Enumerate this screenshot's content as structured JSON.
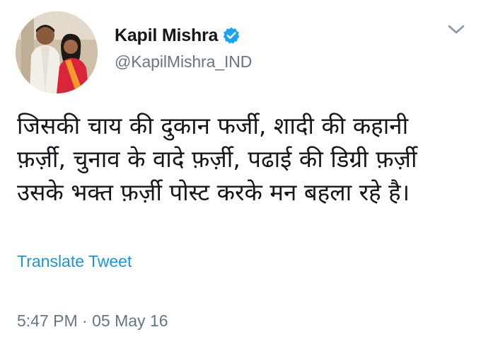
{
  "user": {
    "display_name": "Kapil Mishra",
    "handle": "@KapilMishra_IND",
    "verified": true
  },
  "tweet": {
    "text_lines": [
      "जिसकी चाय की दुकान फर्जी, शादी की कहानी",
      "फ़र्ज़ी, चुनाव के वादे फ़र्ज़ी, पढाई की डिग्री फ़र्ज़ी",
      "उसके भक्त फ़र्ज़ी पोस्ट करके मन बहला रहे है।"
    ],
    "translate_label": "Translate Tweet",
    "timestamp": "5:47 PM · 05 May 16"
  },
  "icons": {
    "verified": "verified-badge-icon",
    "menu": "chevron-down-icon"
  },
  "colors": {
    "link": "#1b95e0",
    "verified": "#1da1f2",
    "secondary_text": "#657786",
    "primary_text": "#14171a"
  }
}
